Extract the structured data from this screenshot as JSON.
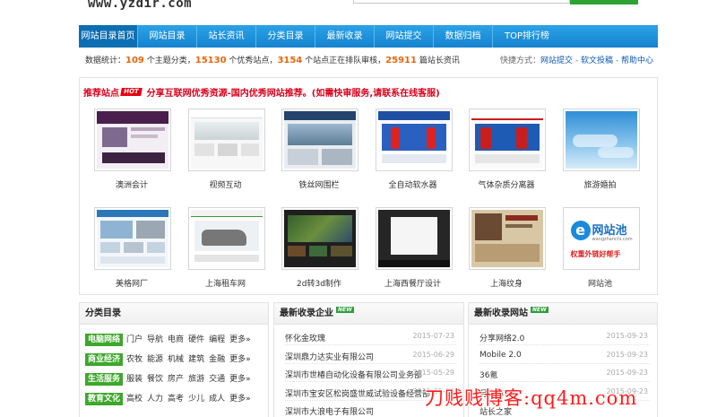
{
  "header": {
    "logo_text": "www.yzdir.com"
  },
  "nav": {
    "items": [
      {
        "label": "网站目录首页",
        "w": 66
      },
      {
        "label": "网站目录",
        "w": 66
      },
      {
        "label": "站长资讯",
        "w": 66
      },
      {
        "label": "分类目录",
        "w": 66
      },
      {
        "label": "最新收录",
        "w": 66
      },
      {
        "label": "网站提交",
        "w": 66
      },
      {
        "label": "数据归档",
        "w": 66
      },
      {
        "label": "TOP排行榜",
        "w": 76
      }
    ]
  },
  "stats": {
    "prefix": "数据统计：",
    "categories": "109",
    "categories_label": " 个主题分类，",
    "quality_sites": "15130",
    "quality_sites_label": " 个优秀站点，",
    "pending": "3154",
    "pending_label": " 个站点正在排队审核，",
    "articles": "25911",
    "articles_label": " 篇站长资讯",
    "quick_label": "快捷方式：",
    "quick_links": [
      "网站提交",
      "软文投稿",
      "帮助中心"
    ]
  },
  "recommended": {
    "title": "推荐站点",
    "hot_badge": "HOT",
    "description": "分享互联网优秀资源-国内优秀网站推荐。(如需快审服务,请联系在线客服)",
    "sites": [
      {
        "label": "澳洲会计",
        "style": "aoz"
      },
      {
        "label": "视频互动",
        "style": "video"
      },
      {
        "label": "铁丝网围栏",
        "style": "fence"
      },
      {
        "label": "全自动软水器",
        "style": "water"
      },
      {
        "label": "气体杂质分离器",
        "style": "gas"
      },
      {
        "label": "旅游婚拍",
        "style": "sky"
      },
      {
        "label": "美格网厂",
        "style": "meige"
      },
      {
        "label": "上海租车网",
        "style": "car"
      },
      {
        "label": "2d转3d制作",
        "style": "film"
      },
      {
        "label": "上海西餐厅设计",
        "style": "dark"
      },
      {
        "label": "上海纹身",
        "style": "tattoo"
      },
      {
        "label": "网站池",
        "style": "logo",
        "logo_main": "网站池",
        "logo_url": "wangzhanchi.com",
        "logo_slogan": "权重外链好帮手"
      }
    ]
  },
  "categories_panel": {
    "title": "分类目录",
    "rows": [
      {
        "tag": "电脑网络",
        "links": [
          "门户",
          "导航",
          "电商",
          "硬件",
          "编程"
        ],
        "more": "更多»"
      },
      {
        "tag": "商业经济",
        "links": [
          "农牧",
          "能源",
          "机械",
          "建筑",
          "金融"
        ],
        "more": "更多»"
      },
      {
        "tag": "生活服务",
        "links": [
          "服装",
          "餐饮",
          "房产",
          "旅游",
          "交通"
        ],
        "more": "更多»"
      },
      {
        "tag": "教育文化",
        "links": [
          "高校",
          "人力",
          "高考",
          "少儿",
          "成人"
        ],
        "more": "更多»"
      }
    ]
  },
  "latest_companies": {
    "title": "最新收录企业",
    "new_badge": "NEW",
    "items": [
      {
        "name": "怀化金玫瑰",
        "date": "2015-07-23"
      },
      {
        "name": "深圳鼎力达实业有限公司",
        "date": "2015-06-29"
      },
      {
        "name": "深圳市世椿自动化设备有限公司业务部",
        "date": "2015-05-29"
      },
      {
        "name": "深圳市宝安区松岗盛世威试验设备经营部",
        "date": "2015-05-28"
      },
      {
        "name": "深圳市大浪电子有限公司",
        "date": ""
      }
    ]
  },
  "latest_sites": {
    "title": "最新收录网站",
    "new_badge": "NEW",
    "items": [
      {
        "name": "分享网络2.0",
        "date": "2015-09-23"
      },
      {
        "name": "Mobile 2.0",
        "date": "2015-09-23"
      },
      {
        "name": "36氪",
        "date": "2015-09-23"
      },
      {
        "name": "月光博客",
        "date": "2015-09-23"
      },
      {
        "name": "站长之家",
        "date": ""
      }
    ]
  },
  "watermark": {
    "text": "刀贱贱博客:qq4m.com"
  }
}
